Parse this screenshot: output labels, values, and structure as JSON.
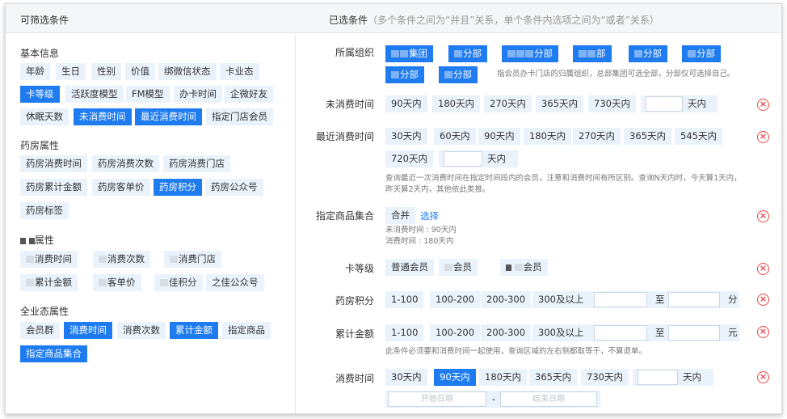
{
  "header": {
    "left_title": "可筛选条件",
    "right_title": "已选条件",
    "right_subtitle": "（多个条件之间为“并且”关系，单个条件内选项之间为“或者”关系）"
  },
  "left": {
    "basic": {
      "title": "基本信息",
      "chips": [
        "年龄",
        "生日",
        "性别",
        "价值",
        "绑微信状态",
        "卡业态",
        "卡等级",
        "活跃度模型",
        "FM模型",
        "办卡时间",
        "企微好友",
        "休眠天数",
        "未消费时间",
        "最近消费时间",
        "指定门店会员"
      ]
    },
    "pharmacy": {
      "title": "药房属性",
      "chips": [
        "药房消费时间",
        "药房消费次数",
        "药房消费门店",
        "药房累计金额",
        "药房客单价",
        "药房积分",
        "药房公众号",
        "药房标签"
      ]
    },
    "other": {
      "title": "属性",
      "chips": [
        "消费时间",
        "消费次数",
        "消费门店",
        "累计金额",
        "客单价",
        "佳积分",
        "之佳公众号"
      ]
    },
    "enterprise": {
      "title": "全业态属性",
      "chips": [
        "会员群",
        "消费时间",
        "消费次数",
        "累计金额",
        "指定商品",
        "指定商品集合"
      ]
    }
  },
  "right": {
    "org": {
      "label": "所属组织",
      "chips": [
        "集团",
        "分部",
        "分部",
        "部",
        "分部",
        "分部",
        "分部",
        "分部"
      ],
      "note": "指会员办卡门店的归属组织，总部集团可选全部，分部仅可选择自己。"
    },
    "unconsumed": {
      "label": "未消费时间",
      "opts": [
        "90天内",
        "180天内",
        "270天内",
        "365天内",
        "730天内"
      ],
      "custom_suffix": "天内"
    },
    "recent": {
      "label": "最近消费时间",
      "opts": [
        "30天内",
        "60天内",
        "90天内",
        "180天内",
        "270天内",
        "365天内",
        "545天内",
        "720天内"
      ],
      "custom_suffix": "天内",
      "note1": "查询最近一次消费时间在指定时间段内的会员，注意和消费时间有所区别。查询N天内时，今天算1天内，",
      "note2": "昨天算2天内，其他依此类推。"
    },
    "product_set": {
      "label": "指定商品集合",
      "merge": "合并",
      "select": "选择",
      "line1": "未消费时间 : 90天内",
      "line2": "消费时间 : 180天内"
    },
    "card_level": {
      "label": "卡等级",
      "opts": [
        "普通会员",
        "会员",
        "会员"
      ]
    },
    "points": {
      "label": "药房积分",
      "opts": [
        "1-100",
        "100-200",
        "200-300",
        "300及以上"
      ],
      "to": "至",
      "unit": "分"
    },
    "amount": {
      "label": "累计金额",
      "opts": [
        "1-100",
        "100-200",
        "200-300",
        "300及以上"
      ],
      "to": "至",
      "unit": "元",
      "note": "此条件必须要和消费时间一起使用，查询区域的左右侧都取等于，不算退单。"
    },
    "consume": {
      "label": "消费时间",
      "opts": [
        "30天内",
        "90天内",
        "180天内",
        "365天内",
        "730天内"
      ],
      "custom_suffix": "天内",
      "start_ph": "开始日期",
      "sep": "-",
      "end_ph": "结束日期"
    },
    "delete_glyph": "×"
  }
}
